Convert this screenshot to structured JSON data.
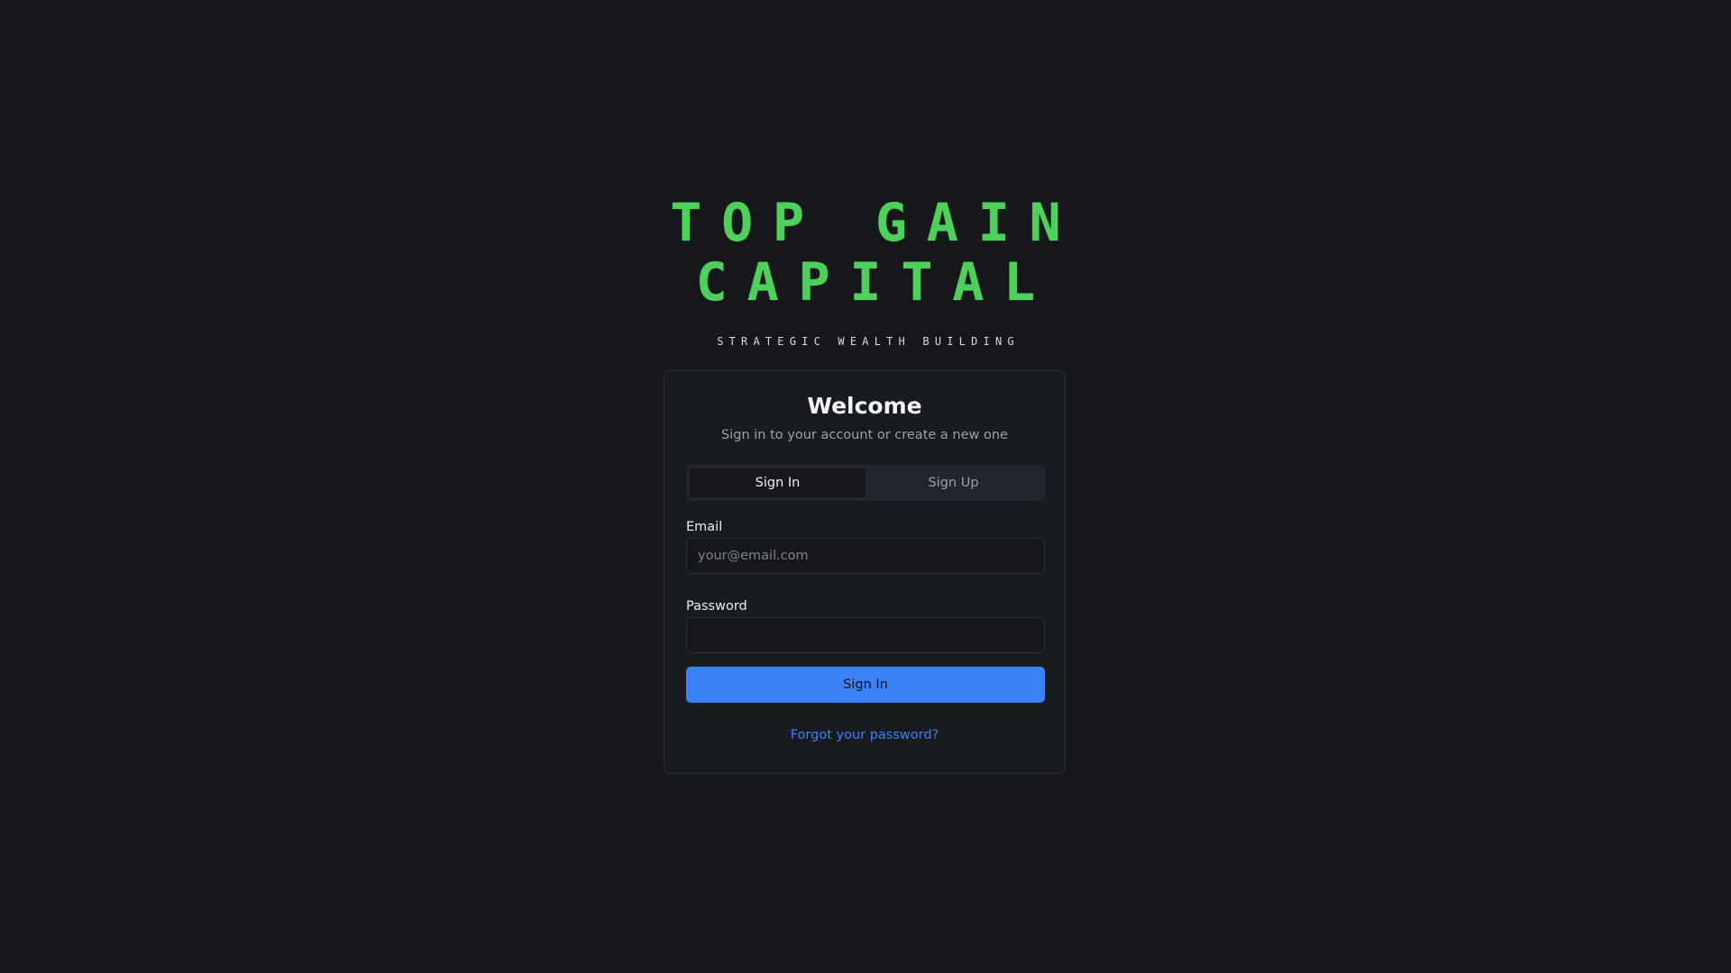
{
  "brand": {
    "logo_line_1": "TOP GAIN",
    "logo_line_2": "CAPITAL",
    "tagline": "STRATEGIC WEALTH BUILDING"
  },
  "auth": {
    "title": "Welcome",
    "subtitle": "Sign in to your account or create a new one",
    "tabs": [
      {
        "label": "Sign In",
        "active": true
      },
      {
        "label": "Sign Up",
        "active": false
      }
    ],
    "email": {
      "label": "Email",
      "placeholder": "your@email.com",
      "value": ""
    },
    "password": {
      "label": "Password",
      "value": ""
    },
    "submit_label": "Sign In",
    "forgot_label": "Forgot your password?"
  },
  "colors": {
    "background": "#15171b",
    "logo_green": "#4fd05c",
    "accent_blue": "#3b82f6"
  }
}
